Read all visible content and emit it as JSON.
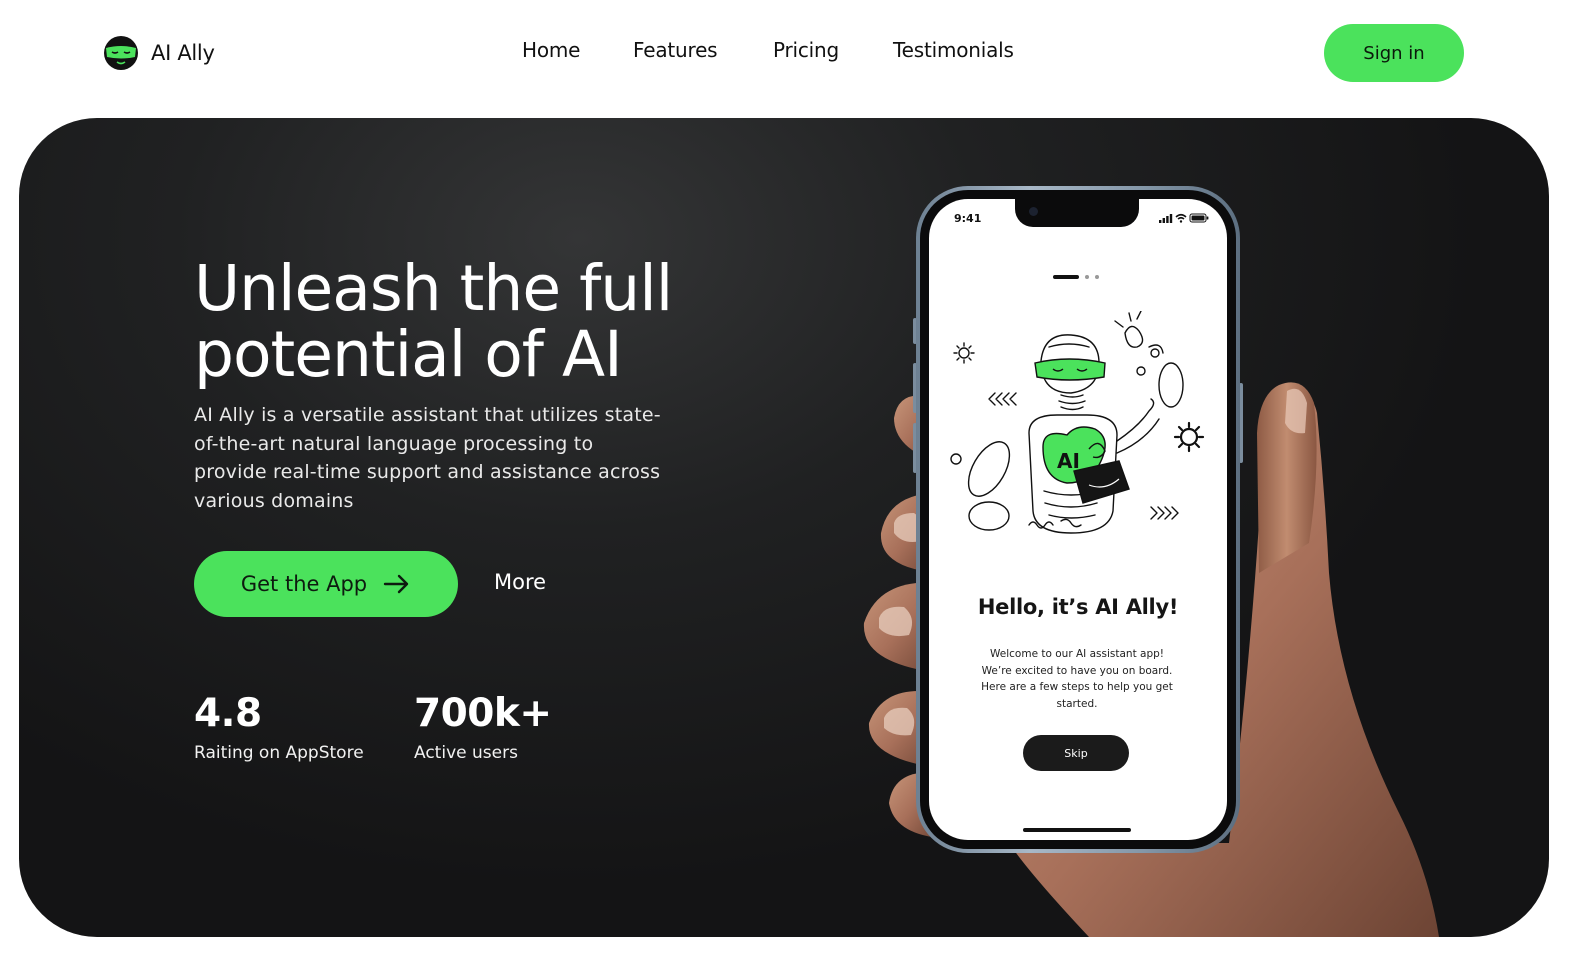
{
  "brand": {
    "name": "AI Ally",
    "logo_icon": "masked-face-icon",
    "accent": "#4be25c"
  },
  "nav": {
    "links": [
      "Home",
      "Features",
      "Pricing",
      "Testimonials"
    ],
    "sign_in": "Sign in"
  },
  "hero": {
    "headline": "Unleash the full potential of AI",
    "description": "AI Ally is a versatile assistant that utilizes state-of-the-art natural language processing to provide real-time support and assistance across various domains",
    "cta_label": "Get the App",
    "cta_icon": "arrow-right-icon",
    "more_label": "More",
    "stats": [
      {
        "value": "4.8",
        "label": "Raiting on AppStore"
      },
      {
        "value": "700k+",
        "label": "Active users"
      }
    ]
  },
  "phone": {
    "status_time": "9:41",
    "illustration_label": "AI",
    "title": "Hello, it’s AI Ally!",
    "body": "Welcome to our AI assistant app! We’re excited to have you on board. Here are a few steps to help you get started.",
    "skip_label": "Skip"
  },
  "colors": {
    "accent": "#4be25c",
    "hero_bg": "#1c1c1d",
    "text_dark": "#111111"
  }
}
